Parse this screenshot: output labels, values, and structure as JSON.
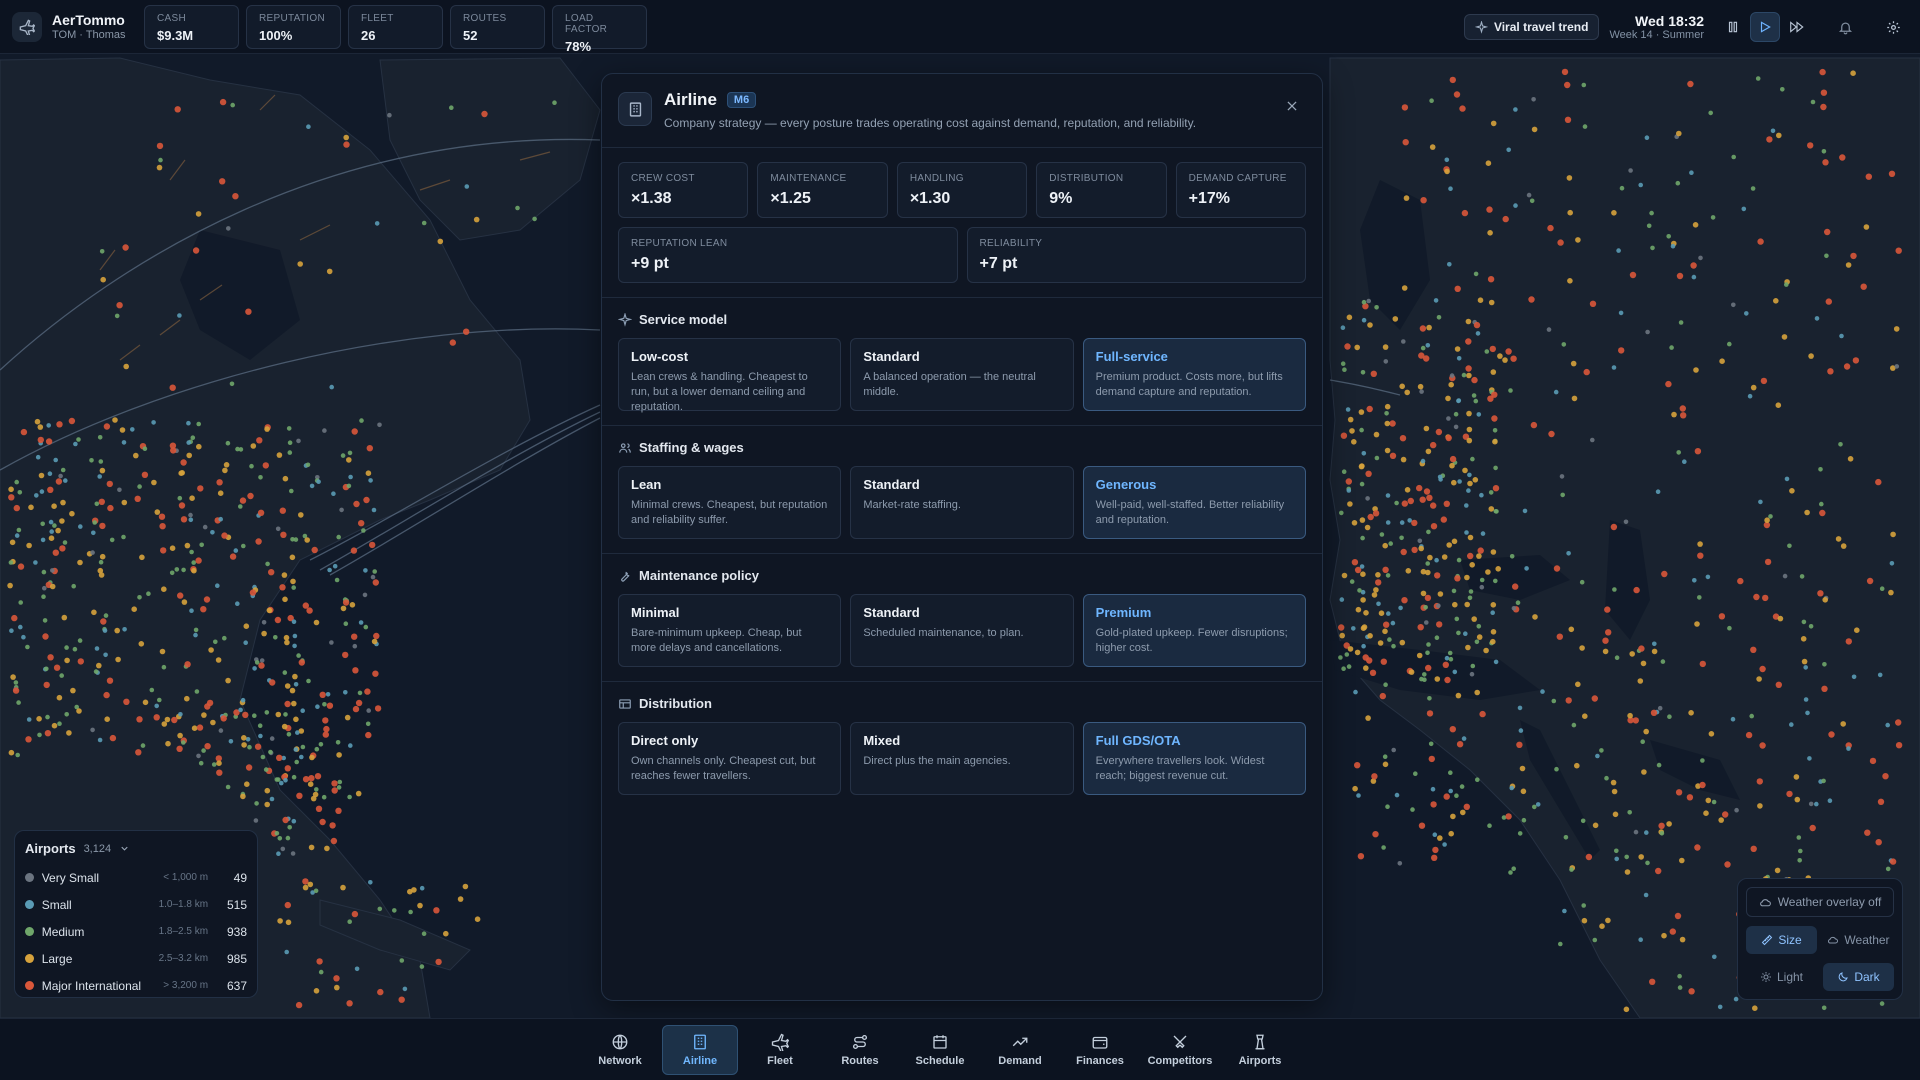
{
  "brand": {
    "name": "AerTommo",
    "sub": "TOM · Thomas"
  },
  "stats": [
    {
      "label": "CASH",
      "value": "$9.3M"
    },
    {
      "label": "REPUTATION",
      "value": "100%"
    },
    {
      "label": "FLEET",
      "value": "26"
    },
    {
      "label": "ROUTES",
      "value": "52"
    },
    {
      "label": "LOAD FACTOR",
      "value": "78%"
    }
  ],
  "topbar": {
    "trend_label": "Viral travel trend",
    "time": "Wed 18:32",
    "week": "Week 14 · Summer"
  },
  "panel": {
    "title": "Airline",
    "badge": "M6",
    "subtitle": "Company strategy — every posture trades operating cost against demand, reputation, and reliability.",
    "metrics_row1": [
      {
        "label": "CREW COST",
        "value": "×1.38"
      },
      {
        "label": "MAINTENANCE",
        "value": "×1.25"
      },
      {
        "label": "HANDLING",
        "value": "×1.30"
      },
      {
        "label": "DISTRIBUTION",
        "value": "9%"
      },
      {
        "label": "DEMAND CAPTURE",
        "value": "+17%"
      }
    ],
    "metrics_row2": [
      {
        "label": "REPUTATION LEAN",
        "value": "+9 pt"
      },
      {
        "label": "RELIABILITY",
        "value": "+7 pt"
      }
    ],
    "sections": [
      {
        "title": "Service model",
        "icon": "sparkle-icon",
        "options": [
          {
            "name": "Low-cost",
            "desc": "Lean crews & handling. Cheapest to run, but a lower demand ceiling and reputation."
          },
          {
            "name": "Standard",
            "desc": "A balanced operation — the neutral middle."
          },
          {
            "name": "Full-service",
            "desc": "Premium product. Costs more, but lifts demand capture and reputation."
          }
        ],
        "selected": 2
      },
      {
        "title": "Staffing & wages",
        "icon": "users-icon",
        "options": [
          {
            "name": "Lean",
            "desc": "Minimal crews. Cheapest, but reputation and reliability suffer."
          },
          {
            "name": "Standard",
            "desc": "Market-rate staffing."
          },
          {
            "name": "Generous",
            "desc": "Well-paid, well-staffed. Better reliability and reputation."
          }
        ],
        "selected": 2
      },
      {
        "title": "Maintenance policy",
        "icon": "wrench-icon",
        "options": [
          {
            "name": "Minimal",
            "desc": "Bare-minimum upkeep. Cheap, but more delays and cancellations."
          },
          {
            "name": "Standard",
            "desc": "Scheduled maintenance, to plan."
          },
          {
            "name": "Premium",
            "desc": "Gold-plated upkeep. Fewer disruptions; higher cost."
          }
        ],
        "selected": 2
      },
      {
        "title": "Distribution",
        "icon": "channels-icon",
        "options": [
          {
            "name": "Direct only",
            "desc": "Own channels only. Cheapest cut, but reaches fewer travellers."
          },
          {
            "name": "Mixed",
            "desc": "Direct plus the main agencies."
          },
          {
            "name": "Full GDS/OTA",
            "desc": "Everywhere travellers look. Widest reach; biggest revenue cut."
          }
        ],
        "selected": 2
      }
    ]
  },
  "legend": {
    "title": "Airports",
    "count": "3,124",
    "rows": [
      {
        "name": "Very Small",
        "range": "< 1,000 m",
        "count": "49",
        "color": "#6b7480"
      },
      {
        "name": "Small",
        "range": "1.0–1.8 km",
        "count": "515",
        "color": "#5a9bb5"
      },
      {
        "name": "Medium",
        "range": "1.8–2.5 km",
        "count": "938",
        "color": "#6fa66a"
      },
      {
        "name": "Large",
        "range": "2.5–3.2 km",
        "count": "985",
        "color": "#d6a23c"
      },
      {
        "name": "Major International",
        "range": "> 3,200 m",
        "count": "637",
        "color": "#d9573a"
      }
    ]
  },
  "overlay": {
    "weather_off": "Weather overlay off",
    "size": "Size",
    "weather": "Weather",
    "light": "Light",
    "dark": "Dark"
  },
  "nav": [
    {
      "label": "Network",
      "icon": "globe-icon"
    },
    {
      "label": "Airline",
      "icon": "building-icon"
    },
    {
      "label": "Fleet",
      "icon": "plane-icon"
    },
    {
      "label": "Routes",
      "icon": "route-icon"
    },
    {
      "label": "Schedule",
      "icon": "calendar-icon"
    },
    {
      "label": "Demand",
      "icon": "trend-icon"
    },
    {
      "label": "Finances",
      "icon": "wallet-icon"
    },
    {
      "label": "Competitors",
      "icon": "swords-icon"
    },
    {
      "label": "Airports",
      "icon": "tower-icon"
    }
  ],
  "nav_active": 1,
  "colors": {
    "accent": "#6fb6ff",
    "panel": "#0f1623",
    "map_land": "#1a2434",
    "map_sea": "#111a29"
  }
}
